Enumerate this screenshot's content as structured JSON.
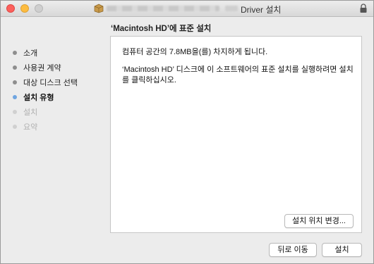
{
  "window": {
    "title": "Driver 설치",
    "subtitle": "‘Macintosh HD’에 표준 설치"
  },
  "sidebar": {
    "steps": [
      {
        "label": "소개",
        "state": "done"
      },
      {
        "label": "사용권 계약",
        "state": "done"
      },
      {
        "label": "대상 디스크 선택",
        "state": "done"
      },
      {
        "label": "설치 유형",
        "state": "current"
      },
      {
        "label": "설치",
        "state": "future"
      },
      {
        "label": "요약",
        "state": "future"
      }
    ]
  },
  "content": {
    "space_message": "컴퓨터 공간의 7.8MB을(를) 차지하게 됩니다.",
    "instruction": "‘Macintosh HD’ 디스크에 이 소프트웨어의 표준 설치를 실행하려면 설치를 클릭하십시오.",
    "change_location_label": "설치 위치 변경..."
  },
  "footer": {
    "back_label": "뒤로 이동",
    "install_label": "설치"
  },
  "colors": {
    "current_step_dot": "#6fa5e0",
    "close": "#fc605c",
    "minimize": "#fdbc40"
  }
}
